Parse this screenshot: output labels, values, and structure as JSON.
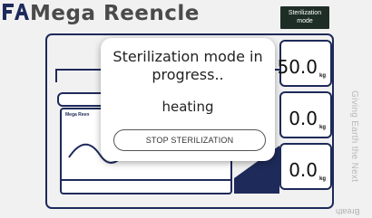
{
  "brand": {
    "name": "Mega Reencle"
  },
  "header": {
    "mode_badge": "Sterilization mode"
  },
  "machine": {
    "label": "Mega Reen"
  },
  "weights": [
    {
      "value": "50.0",
      "unit": "kg"
    },
    {
      "value": "0.0",
      "unit": "kg"
    },
    {
      "value": "0.0",
      "unit": "kg"
    }
  ],
  "side_text": {
    "vertical": "Giving Earth the Next",
    "bottom": "Breath"
  },
  "modal": {
    "title": "Sterilization mode in progress..",
    "status": "heating",
    "stop_label": "STOP STERILIZATION"
  },
  "colors": {
    "navy": "#1e2a5a",
    "badge_bg": "#1e2e26"
  }
}
